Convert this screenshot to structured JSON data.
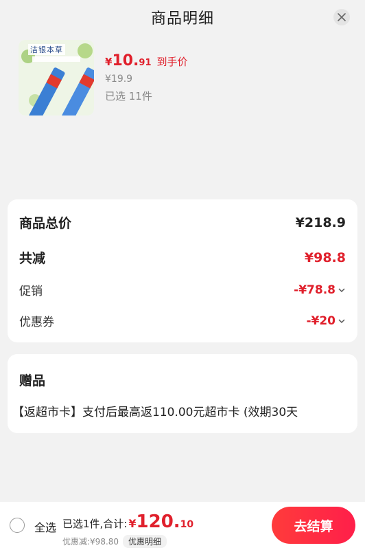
{
  "header": {
    "title": "商品明细"
  },
  "product": {
    "image_title": "洁银本草",
    "price_symbol": "¥",
    "price_int": "10.",
    "price_dec": "91",
    "price_tag": "到手价",
    "original_price": "¥19.9",
    "selected": "已选 11件"
  },
  "totals": {
    "total_label": "商品总价",
    "total_value": "¥218.9",
    "reduce_label": "共减",
    "reduce_value": "¥98.8",
    "promo_label": "促销",
    "promo_value": "-¥78.8",
    "coupon_label": "优惠券",
    "coupon_value": "-¥20"
  },
  "gift": {
    "title": "赠品",
    "text": "【返超市卡】支付后最高返110.00元超市卡 (效期30天"
  },
  "bottom": {
    "select_all": "全选",
    "summary_label": "已选1件,合计:",
    "sum_symbol": "¥",
    "sum_int": "120.",
    "sum_dec": "10",
    "discount": "优惠减:¥98.80",
    "detail_link": "优惠明细",
    "checkout": "去结算"
  },
  "colors": {
    "accent": "#e0202c",
    "background": "#f2f2f2"
  },
  "icons": {
    "close": "close-icon",
    "chevron": "chevron-down-icon",
    "radio": "radio-unchecked-icon"
  }
}
